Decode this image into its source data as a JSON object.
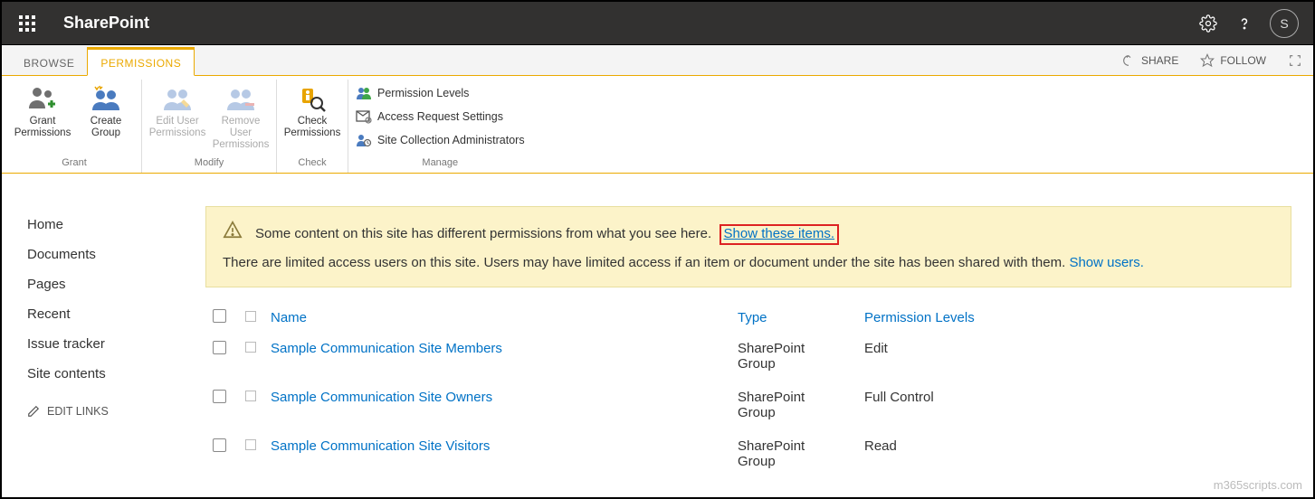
{
  "suite": {
    "app_title": "SharePoint",
    "avatar_initial": "S"
  },
  "tabs": {
    "browse": "BROWSE",
    "permissions": "PERMISSIONS"
  },
  "tab_actions": {
    "share": "SHARE",
    "follow": "FOLLOW"
  },
  "ribbon": {
    "grant_permissions": "Grant\nPermissions",
    "create_group": "Create\nGroup",
    "grant_label": "Grant",
    "edit_user": "Edit User\nPermissions",
    "remove_user": "Remove User\nPermissions",
    "modify_label": "Modify",
    "check_permissions": "Check\nPermissions",
    "check_label": "Check",
    "permission_levels": "Permission Levels",
    "access_request": "Access Request Settings",
    "site_collection_admins": "Site Collection Administrators",
    "manage_label": "Manage"
  },
  "leftnav": {
    "home": "Home",
    "documents": "Documents",
    "pages": "Pages",
    "recent": "Recent",
    "issue_tracker": "Issue tracker",
    "site_contents": "Site contents",
    "edit_links": "EDIT LINKS"
  },
  "alert": {
    "line1_text": "Some content on this site has different permissions from what you see here.",
    "line1_link": "Show these items.",
    "line2_text": "There are limited access users on this site. Users may have limited access if an item or document under the site has been shared with them.",
    "line2_link": "Show users."
  },
  "table": {
    "col_name": "Name",
    "col_type": "Type",
    "col_perm": "Permission Levels",
    "rows": [
      {
        "name": "Sample Communication Site Members",
        "type": "SharePoint Group",
        "perm": "Edit"
      },
      {
        "name": "Sample Communication Site Owners",
        "type": "SharePoint Group",
        "perm": "Full Control"
      },
      {
        "name": "Sample Communication Site Visitors",
        "type": "SharePoint Group",
        "perm": "Read"
      }
    ]
  },
  "watermark": "m365scripts.com"
}
